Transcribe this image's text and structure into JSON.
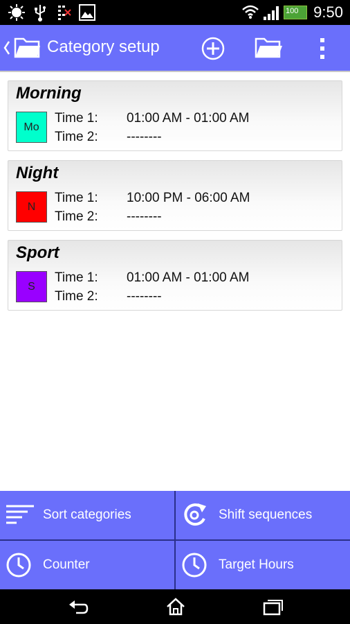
{
  "status_bar": {
    "time": "9:50",
    "battery_label": "100",
    "icons": [
      "debug-icon",
      "usb-icon",
      "sim-icon",
      "image-icon",
      "wifi-icon",
      "signal-icon",
      "battery-icon"
    ]
  },
  "action_bar": {
    "title": "Category setup",
    "icons": [
      "back-chevron-icon",
      "folder-icon",
      "add-icon",
      "open-folder-icon",
      "overflow-menu-icon"
    ]
  },
  "time1_label": "Time 1:",
  "time2_label": "Time 2:",
  "categories": [
    {
      "name": "Morning",
      "abbr": "Mo",
      "color": "#00ffcc",
      "time1": "01:00 AM - 01:00 AM",
      "time2": "--------"
    },
    {
      "name": "Night",
      "abbr": "N",
      "color": "#ff0000",
      "time1": "10:00 PM - 06:00 AM",
      "time2": "--------"
    },
    {
      "name": "Sport",
      "abbr": "S",
      "color": "#9900ff",
      "time1": "01:00 AM - 01:00 AM",
      "time2": "--------"
    }
  ],
  "bottom_buttons": [
    {
      "label": "Sort categories",
      "icon": "sort-icon"
    },
    {
      "label": "Shift sequences",
      "icon": "refresh-icon"
    },
    {
      "label": "Counter",
      "icon": "clock-icon"
    },
    {
      "label": "Target Hours",
      "icon": "clock-icon"
    }
  ],
  "colors": {
    "accent": "#6a6ffb",
    "bar_bg": "#000000"
  },
  "nav_bar": {
    "icons": [
      "back-icon",
      "home-icon",
      "recents-icon"
    ]
  }
}
